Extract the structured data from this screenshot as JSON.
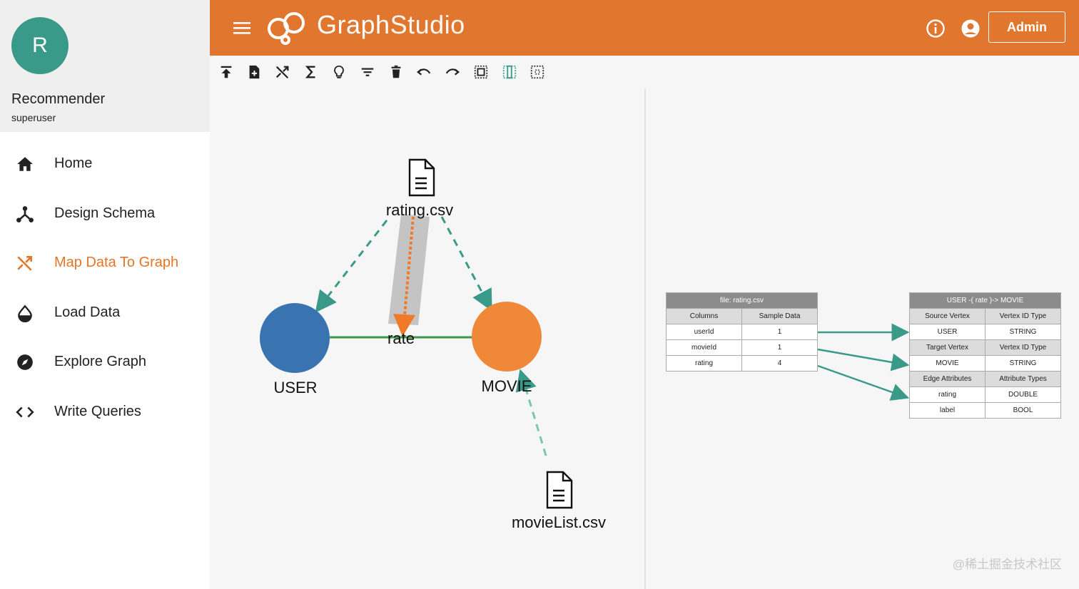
{
  "profile": {
    "avatar_letter": "R",
    "graph_name": "Recommender",
    "role": "superuser"
  },
  "nav": [
    {
      "label": "Home",
      "icon": "home-icon"
    },
    {
      "label": "Design Schema",
      "icon": "schema-icon"
    },
    {
      "label": "Map Data To Graph",
      "icon": "shuffle-icon",
      "active": true
    },
    {
      "label": "Load Data",
      "icon": "drop-icon"
    },
    {
      "label": "Explore Graph",
      "icon": "compass-icon"
    },
    {
      "label": "Write Queries",
      "icon": "code-icon"
    }
  ],
  "header": {
    "brand_bold": "Graph",
    "brand_light": "Studio",
    "admin_label": "Admin"
  },
  "toolbar": [
    "upload-icon",
    "add-file-icon",
    "shuffle-icon",
    "sigma-icon",
    "bulb-icon",
    "filter-icon",
    "delete-icon",
    "undo-icon",
    "redo-icon",
    "select-all-icon",
    "select-middle-icon",
    "deselect-icon"
  ],
  "canvas": {
    "file_rating": "rating.csv",
    "file_movielist": "movieList.csv",
    "vertex_user": "USER",
    "vertex_movie": "MOVIE",
    "edge_rate": "rate"
  },
  "source_table": {
    "title": "file: rating.csv",
    "col1": "Columns",
    "col2": "Sample Data",
    "rows": [
      {
        "c": "userId",
        "v": "1"
      },
      {
        "c": "movieId",
        "v": "1"
      },
      {
        "c": "rating",
        "v": "4"
      }
    ]
  },
  "target_table": {
    "title": "USER -( rate )-> MOVIE",
    "src_head": "Source Vertex",
    "src_type_head": "Vertex ID Type",
    "src_val": "USER",
    "src_type": "STRING",
    "tgt_head": "Target Vertex",
    "tgt_type_head": "Vertex ID Type",
    "tgt_val": "MOVIE",
    "tgt_type": "STRING",
    "attr_head": "Edge Attributes",
    "attr_type_head": "Attribute Types",
    "attrs": [
      {
        "n": "rating",
        "t": "DOUBLE"
      },
      {
        "n": "label",
        "t": "BOOL"
      }
    ]
  },
  "colors": {
    "accent": "#e1762f",
    "user_vertex": "#3a74b0",
    "movie_vertex": "#f0883a",
    "edge": "#3a9a4a",
    "mapping": "#3a9a8a"
  },
  "watermark": "@稀土掘金技术社区"
}
